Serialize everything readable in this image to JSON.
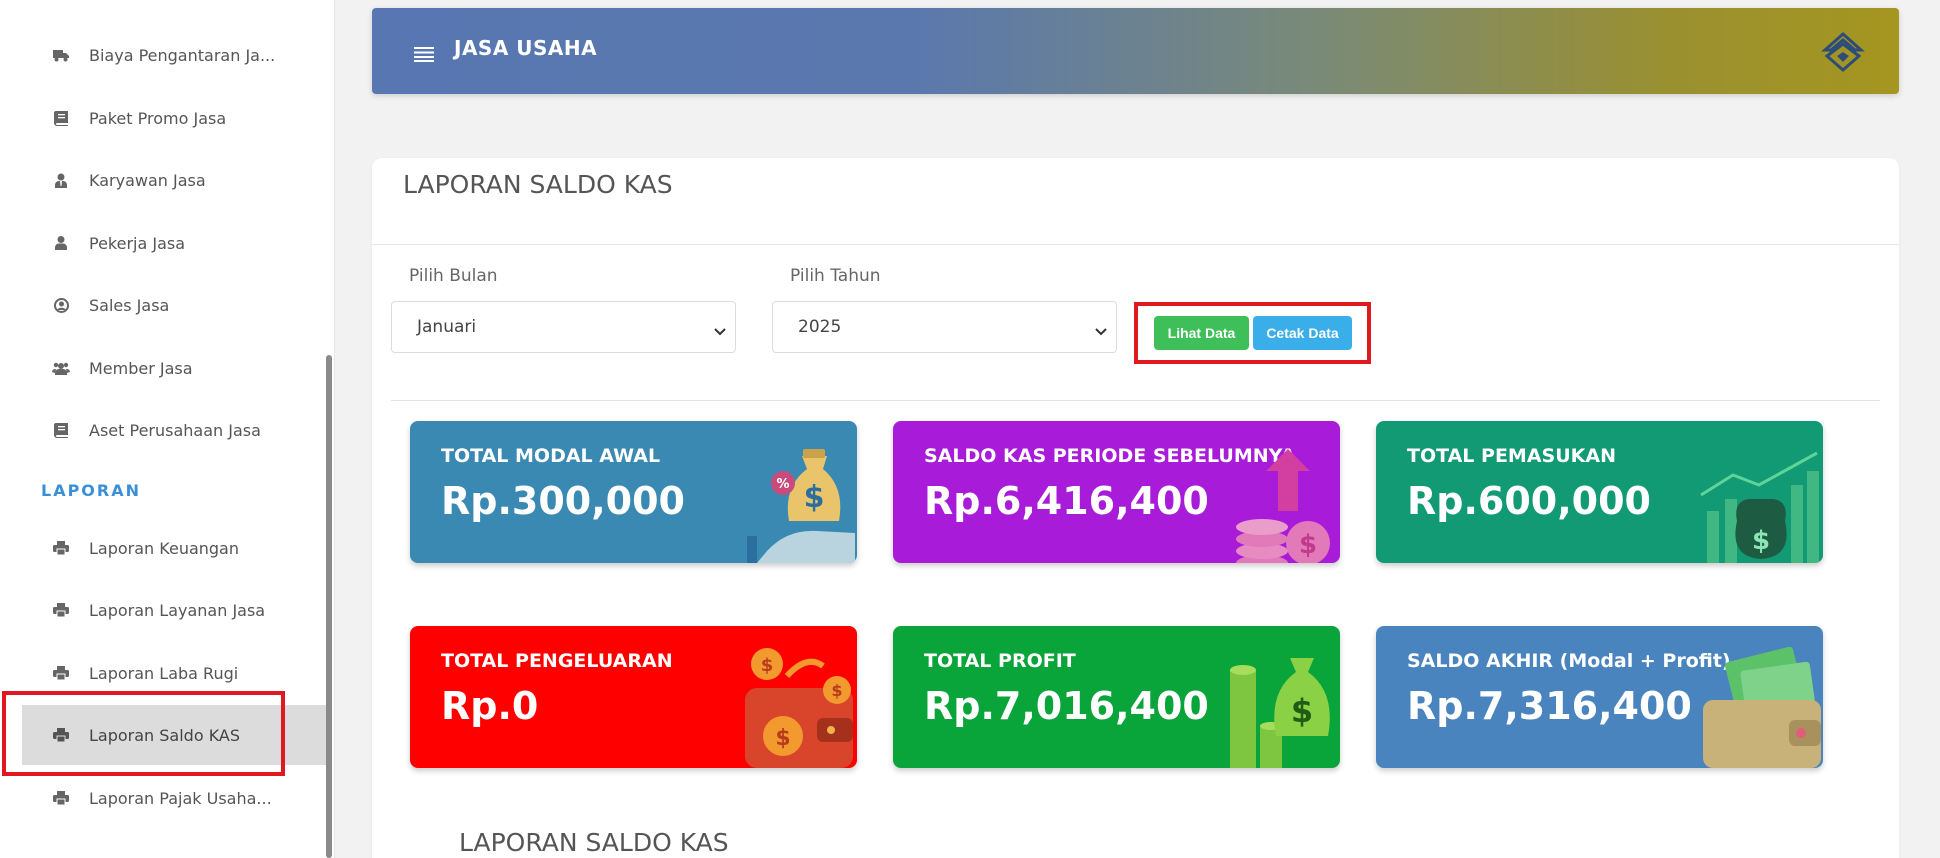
{
  "sidebar": {
    "items": [
      {
        "label": "Biaya Pengantaran Ja...",
        "icon": "truck-icon"
      },
      {
        "label": "Paket Promo Jasa",
        "icon": "book-icon"
      },
      {
        "label": "Karyawan Jasa",
        "icon": "user-tie-icon"
      },
      {
        "label": "Pekerja Jasa",
        "icon": "user-icon"
      },
      {
        "label": "Sales Jasa",
        "icon": "user-circle-icon"
      },
      {
        "label": "Member Jasa",
        "icon": "users-icon"
      },
      {
        "label": "Aset Perusahaan Jasa",
        "icon": "book-icon"
      }
    ],
    "section_label": "LAPORAN",
    "report_items": [
      {
        "label": "Laporan Keuangan",
        "icon": "printer-icon"
      },
      {
        "label": "Laporan Layanan Jasa",
        "icon": "printer-icon"
      },
      {
        "label": "Laporan Laba Rugi",
        "icon": "printer-icon"
      },
      {
        "label": "Laporan Saldo KAS",
        "icon": "printer-icon",
        "active": true
      },
      {
        "label": "Laporan Pajak Usaha...",
        "icon": "printer-icon"
      }
    ]
  },
  "header": {
    "title": "JASA USAHA",
    "menu_icon": "hamburger-icon",
    "logo_icon": "brand-logo-icon"
  },
  "main": {
    "title": "LAPORAN SALDO KAS",
    "filters": {
      "month_label": "Pilih Bulan",
      "month_value": "Januari",
      "year_label": "Pilih Tahun",
      "year_value": "2025"
    },
    "buttons": {
      "view": "Lihat Data",
      "print": "Cetak Data"
    },
    "stats": [
      {
        "title": "TOTAL MODAL AWAL",
        "value": "Rp.300,000",
        "color": "#3a89b2",
        "icon": "money-bag-hand-icon"
      },
      {
        "title": "SALDO KAS PERIODE SEBELUMNYA",
        "value": "Rp.6,416,400",
        "color": "#a81bd9",
        "icon": "coins-arrow-up-icon"
      },
      {
        "title": "TOTAL PEMASUKAN",
        "value": "Rp.600,000",
        "color": "#119a73",
        "icon": "growth-chart-money-icon"
      },
      {
        "title": "TOTAL PENGELUARAN",
        "value": "Rp.0",
        "color": "#ff0000",
        "icon": "wallet-coins-icon"
      },
      {
        "title": "TOTAL PROFIT",
        "value": "Rp.7,016,400",
        "color": "#0aa53a",
        "icon": "money-bag-coins-icon"
      },
      {
        "title": "SALDO AKHIR (Modal + Profit)",
        "value": "Rp.7,316,400",
        "color": "#4a84bf",
        "icon": "wallet-cash-icon"
      }
    ],
    "subtitle": "LAPORAN SALDO KAS"
  }
}
